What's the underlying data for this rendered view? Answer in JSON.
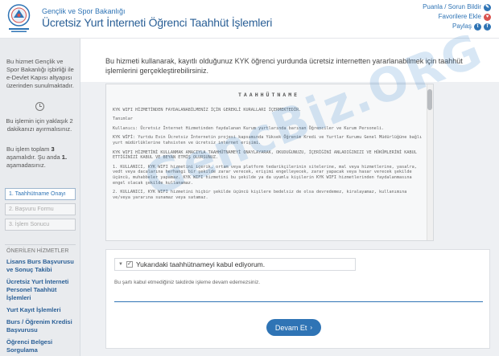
{
  "header": {
    "ministry": "Gençlik ve Spor Bakanlığı",
    "title": "Ücretsiz Yurt İnterneti Öğrenci Taahhüt İşlemleri",
    "links": {
      "support": "Puanla / Sorun Bildir",
      "favorites": "Favorilere Ekle",
      "share": "Paylaş"
    },
    "icons": [
      "comment-icon",
      "heart-icon",
      "twitter-icon",
      "facebook-icon"
    ]
  },
  "sidebar": {
    "info": "Bu hizmet Gençlik ve Spor Bakanlığı işbirliği ile e-Devlet Kapısı altyapısı üzerinden sunulmaktadır.",
    "time": "Bu işlemin için yaklaşık 2 dakikanızı ayırmalısınız.",
    "steps_info_prefix": "Bu işlem toplam ",
    "steps_total": "3",
    "steps_info_mid": " aşamalıdır. Şu anda ",
    "steps_current": "1.",
    "steps_info_suffix": " aşamadasınız.",
    "steps": [
      {
        "label": "1. Taahhütname Onayı"
      },
      {
        "label": "2. Başvuru Formu"
      },
      {
        "label": "3. İşlem Sonucu"
      }
    ],
    "services_title": "ÖNERİLEN HİZMETLER",
    "services": [
      {
        "label": "Lisans Burs Başvurusu ve Sonuç Takibi"
      },
      {
        "label": "Ücretsiz Yurt İnterneti Personel Taahhüt İşlemleri"
      },
      {
        "label": "Yurt Kayıt İşlemleri"
      },
      {
        "label": "Burs / Öğrenim Kredisi Başvurusu"
      },
      {
        "label": "Öğrenci Belgesi Sorgulama"
      }
    ]
  },
  "main": {
    "intro": "Bu hizmeti kullanarak, kayıtlı olduğunuz KYK öğrenci yurdunda ücretsiz internetten yararlanabilmek için taahhüt işlemlerini gerçekleştirebilirsiniz.",
    "contract": {
      "title": "TAAHHÜTNAME",
      "paragraphs": [
        "KYK WIFI HİZMETİNDEN FAYDALANABİLMENİZ İÇİN GEREKLİ KURALLARI İÇERMEKTEDİR.",
        "Tanımlar",
        "Kullanıcı: Ücretsiz İnternet Hizmetinden faydalanan Kurum yurtlarında barınan Öğrenciler ve Kurum Personeli.",
        "KYK WİFİ: Yurtdu Evin Ücretsiz İnternetin projesi kapsamında Yüksek Öğrenim Kredi ve Yurtlar Kurumu Genel Müdürlüğüne bağlı yurt müdürlüklerine tahsisten ve ücretsiz internet erişimi.",
        "KYK WIFI HİZMETİNİ KULLANMAK AMACIYLA TAAHHÜTNAMEYİ ONAYLAYARAK, OKUDUĞUNUZU, İÇERİĞİNİ ANLADIĞINIZI VE HÜKÜMLERİNİ KABUL ETTİĞİNİZİ KABUL VE BEYAN ETMİŞ OLURSUNUZ.",
        "1. KULLANICI, KYK WIFI hizmetini içerik, ortam veya platform tedarikçilerinin sitelerine, mal veya hizmetlerine, yasalra, vedt veya dacalarına herhangi bir şekilde zarar verecek, erişimi engelleyecek, zarar yapacak veya hasar verecek şekilde üçüncü, muhabbeler yapamaz. KYK WIFI hizmetini bu şekilde ya da uyumlu kişilerin KYK WIFI hizmetlerinden faydalanmasına engel olacak şekilde kullanamaz.",
        "2. KULLANICI, KYK WIFI hizmetini hiçbir şekilde üçüncü kişilere bedelsiz de olsa devredemez, kiralayamaz, kullanımına ve/veya yararına sunamaz veya satamaz."
      ]
    },
    "agree_label": "Yukarıdaki taahhütnameyi kabul ediyorum.",
    "agree_note": "Bu şartı kabul etmediğiniz takdirde işleme devam edemezsiniz.",
    "continue_label": "Devam Et",
    "watermark": "GencBiz.ORG"
  }
}
